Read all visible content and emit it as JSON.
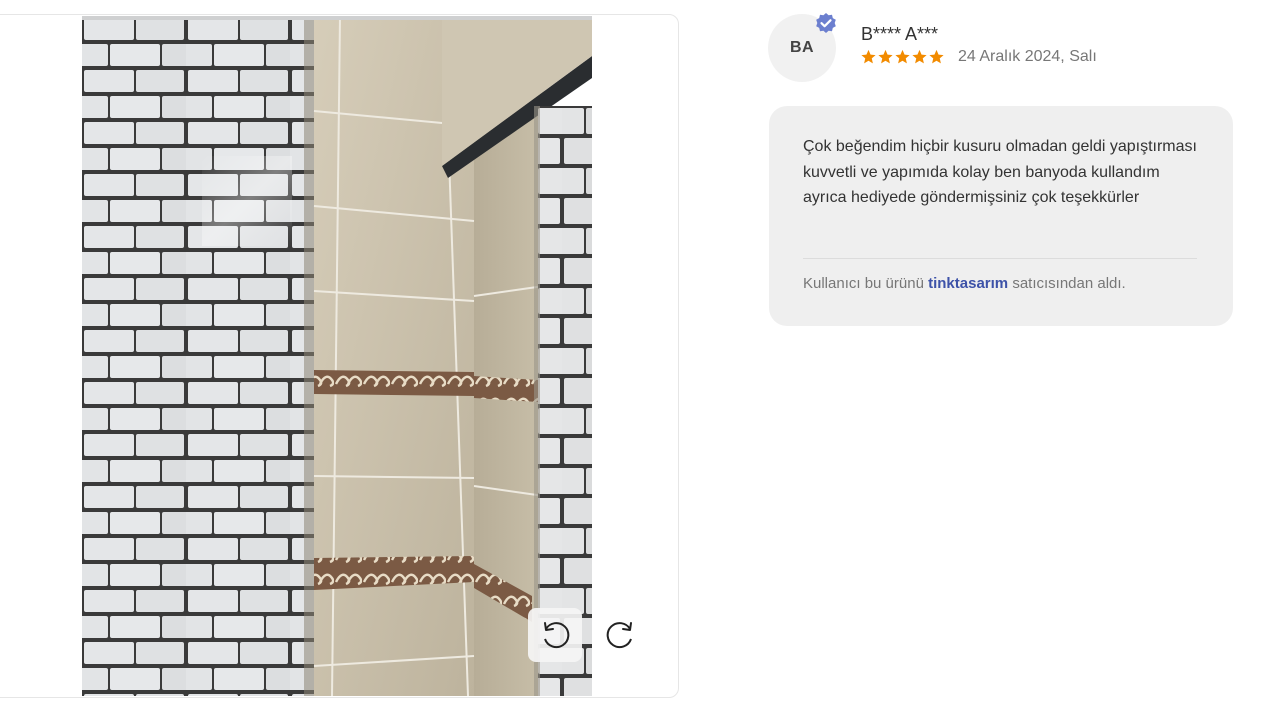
{
  "review": {
    "avatar_initials": "BA",
    "reviewer_name": "B**** A***",
    "rating": 5,
    "date": "24 Aralık 2024, Salı",
    "text": "Çok beğendim hiçbir kusuru olmadan geldi yapıştırması kuvvetli ve yapımıda kolay ben banyoda kullandım ayrıca hediyede göndermişsiniz çok teşekkürler",
    "purchase_prefix": "Kullanıcı bu ürünü",
    "seller_name": "tinktasarım",
    "purchase_suffix": "satıcısından aldı."
  },
  "colors": {
    "star": "#f28b00",
    "verified_badge": "#6c7fcf",
    "seller_link": "#3d52a8",
    "card_bg": "#efefef"
  },
  "icons": {
    "rotate_left": "rotate-left-icon",
    "rotate_right": "rotate-right-icon",
    "verified": "verified-badge-icon",
    "star": "star-icon"
  }
}
